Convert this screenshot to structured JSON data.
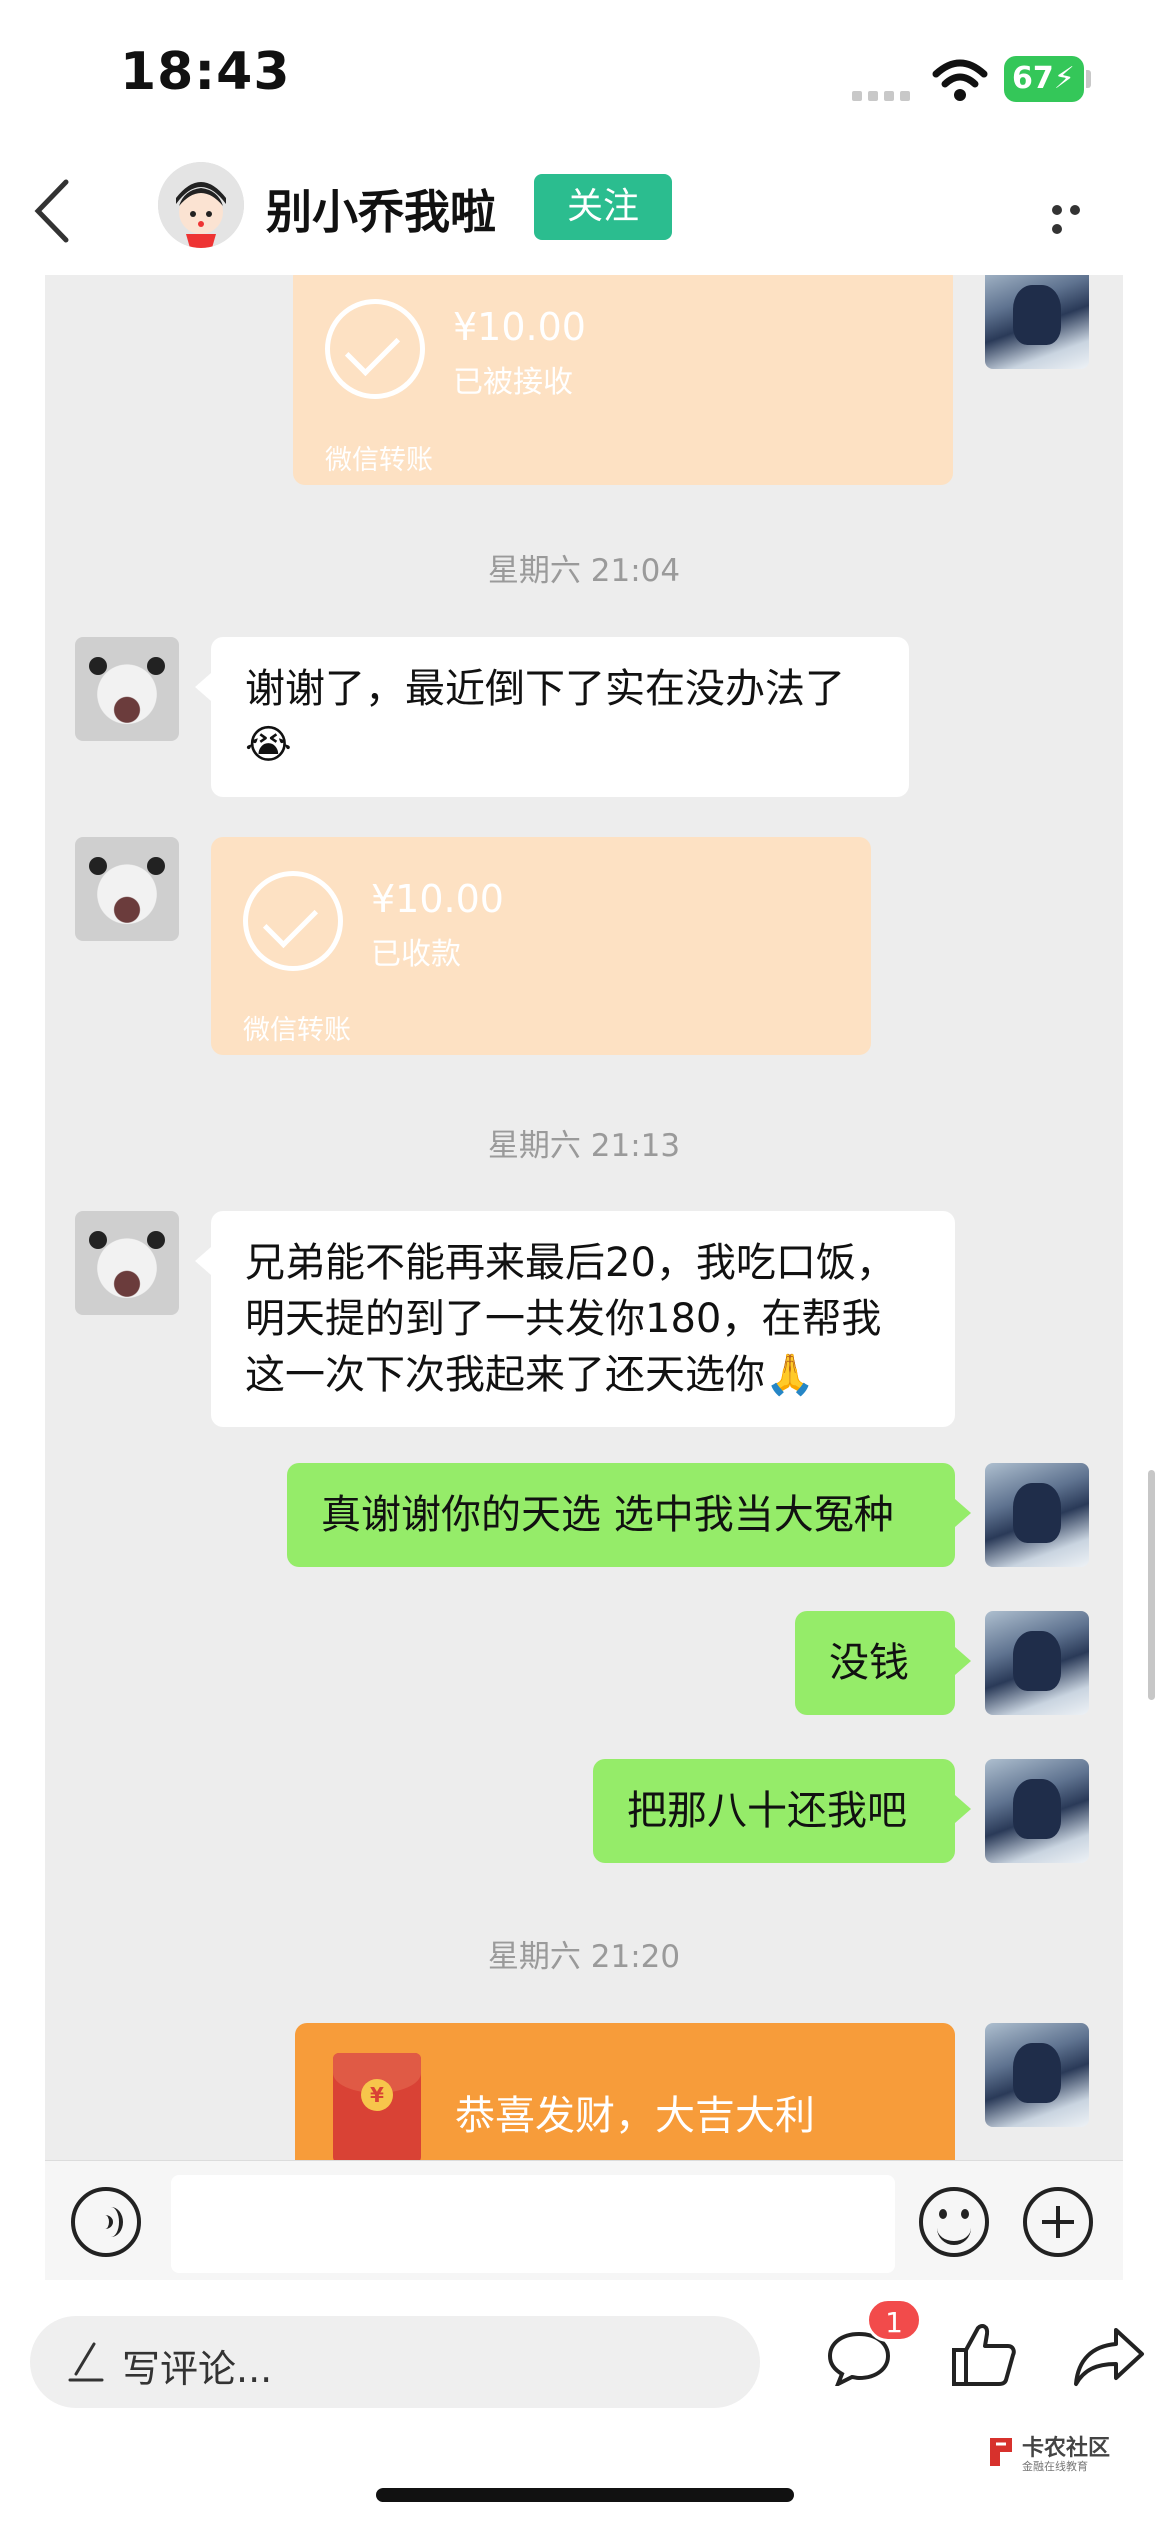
{
  "status_bar": {
    "time": "18:43",
    "battery": "67"
  },
  "header": {
    "username": "别小乔我啦",
    "follow_label": "关注"
  },
  "messages": {
    "transfer_top": {
      "amount": "¥10.00",
      "status": "已被接收",
      "label": "微信转账"
    },
    "ts1": "星期六 21:04",
    "msg1": "谢谢了，最近倒下了实在没办法了😭",
    "transfer_received": {
      "amount": "¥10.00",
      "status": "已收款",
      "label": "微信转账"
    },
    "ts2": "星期六 21:13",
    "msg2": "兄弟能不能再来最后20，我吃口饭，明天提的到了一共发你180，在帮我这一次下次我起来了还天选你🙏",
    "msg3": "真谢谢你的天选 选中我当大冤种",
    "msg4": "没钱",
    "msg5": "把那八十还我吧",
    "ts3": "星期六 21:20",
    "red_packet": {
      "greeting": "恭喜发财，大吉大利",
      "symbol": "¥"
    }
  },
  "comment_bar": {
    "placeholder": "写评论...",
    "comment_badge": "1"
  },
  "watermark": {
    "title": "卡农社区",
    "subtitle": "金融在线教育"
  },
  "colors": {
    "follow": "#2bbd8f",
    "green_bubble": "#95ec69",
    "transfer": "#fde1c3",
    "red_packet": "#f79c3a",
    "badge": "#f24b4b",
    "battery": "#34c759"
  }
}
